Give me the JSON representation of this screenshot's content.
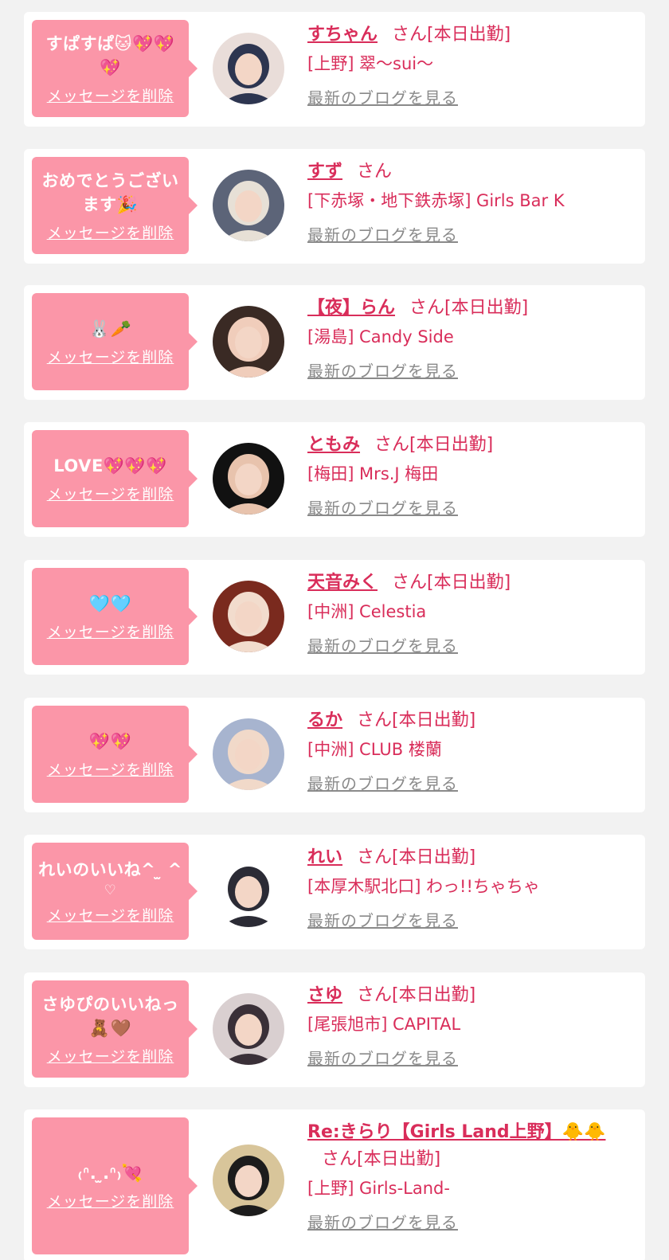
{
  "cards": [
    {
      "message": "すぱすぱ🐱💖💖💖",
      "message_sub": "",
      "delete_label": "メッセージを削除",
      "name": "すちゃん",
      "honorific": "さん",
      "status": "[本日出勤]",
      "shop": "[上野] 翠〜sui〜",
      "blog_label": "最新のブログを見る",
      "avatar_colors": [
        "#e9ddd9",
        "#2d3550"
      ]
    },
    {
      "message": "おめでとうございます🎉",
      "message_sub": "",
      "delete_label": "メッセージを削除",
      "name": "すず",
      "honorific": "さん",
      "status": "",
      "shop": "[下赤塚・地下鉄赤塚] Girls Bar K",
      "blog_label": "最新のブログを見る",
      "avatar_colors": [
        "#5c6478",
        "#e7e0d6"
      ]
    },
    {
      "message": "🐰🥕",
      "message_sub": "",
      "delete_label": "メッセージを削除",
      "name": "【夜】らん",
      "honorific": "さん",
      "status": "[本日出勤]",
      "shop": "[湯島] Candy Side",
      "blog_label": "最新のブログを見る",
      "avatar_colors": [
        "#3a2a24",
        "#f0cdbb"
      ]
    },
    {
      "message": "LOVE💖💖💖",
      "message_sub": "",
      "delete_label": "メッセージを削除",
      "name": "ともみ",
      "honorific": "さん",
      "status": "[本日出勤]",
      "shop": "[梅田] Mrs.J 梅田",
      "blog_label": "最新のブログを見る",
      "avatar_colors": [
        "#111111",
        "#e8c3ad"
      ]
    },
    {
      "message": "🩵🩵",
      "message_sub": "",
      "delete_label": "メッセージを削除",
      "name": "天音みく",
      "honorific": "さん",
      "status": "[本日出勤]",
      "shop": "[中洲] Celestia",
      "blog_label": "最新のブログを見る",
      "avatar_colors": [
        "#7a2a1e",
        "#f2dccd"
      ]
    },
    {
      "message": "💖💖",
      "message_sub": "",
      "delete_label": "メッセージを削除",
      "name": "るか",
      "honorific": "さん",
      "status": "[本日出勤]",
      "shop": "[中洲] CLUB 楼蘭",
      "blog_label": "最新のブログを見る",
      "avatar_colors": [
        "#a7b4cf",
        "#f1d9c9"
      ]
    },
    {
      "message": "れいのいいね^ ̫ ^",
      "message_sub": "♡",
      "delete_label": "メッセージを削除",
      "name": "れい",
      "honorific": "さん",
      "status": "[本日出勤]",
      "shop": "[本厚木駅北口] わっ!!ちゃちゃ",
      "blog_label": "最新のブログを見る",
      "avatar_colors": [
        "#ffffff",
        "#2b2b35"
      ]
    },
    {
      "message": "さゆぴのいいねっ🧸🤎",
      "message_sub": "",
      "delete_label": "メッセージを削除",
      "name": "さゆ",
      "honorific": "さん",
      "status": "[本日出勤]",
      "shop": "[尾張旭市] CAPITAL",
      "blog_label": "最新のブログを見る",
      "avatar_colors": [
        "#d9cfd0",
        "#3a3038"
      ]
    },
    {
      "message": "₍ᐢ. ̫.ᐢ₎💘",
      "message_sub": "",
      "delete_label": "メッセージを削除",
      "name": "Re:きらり【Girls Land上野】🐥🐥",
      "honorific": "さん",
      "status": "[本日出勤]",
      "shop": "[上野] Girls-Land-",
      "blog_label": "最新のブログを見る",
      "avatar_colors": [
        "#d8c59a",
        "#1c1c1c"
      ]
    }
  ]
}
